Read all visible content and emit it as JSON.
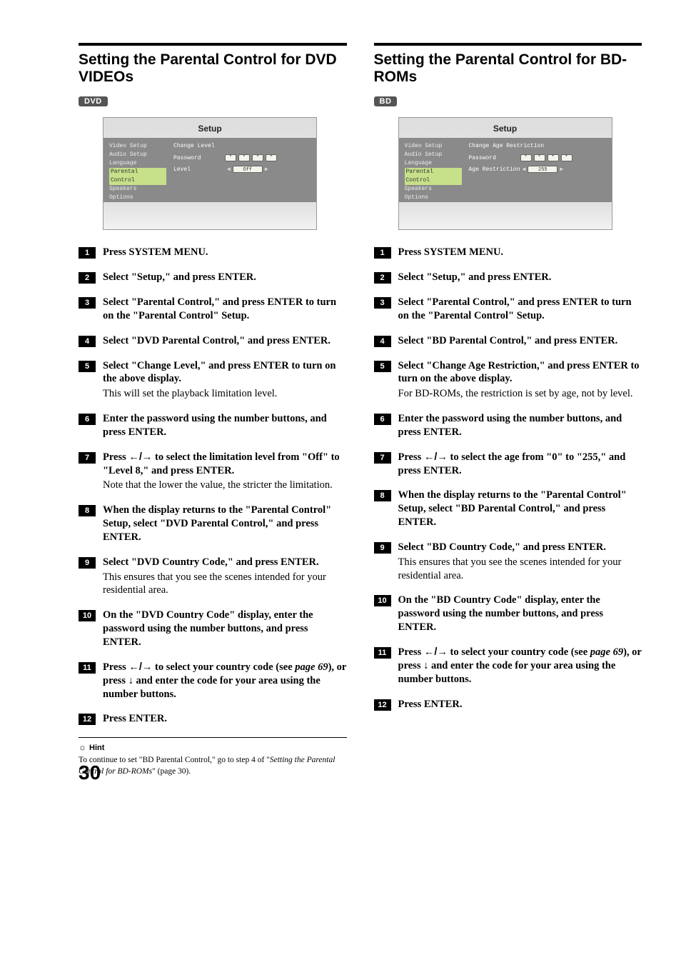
{
  "page_number": "30",
  "left": {
    "title": "Setting the Parental Control for DVD VIDEOs",
    "format_badge": "DVD",
    "osd": {
      "title": "Setup",
      "menu": [
        "Video Setup",
        "Audio Setup",
        "Language",
        "Parental Control",
        "Speakers",
        "Options"
      ],
      "selected_index": 3,
      "pane_title": "Change Level",
      "rows": [
        {
          "label": "Password",
          "value": "****"
        },
        {
          "label": "Level",
          "value": "Off"
        }
      ]
    },
    "steps": [
      {
        "bold": "Press SYSTEM MENU."
      },
      {
        "bold": "Select \"Setup,\" and press ENTER."
      },
      {
        "bold": "Select \"Parental Control,\" and press ENTER to turn on the \"Parental Control\" Setup."
      },
      {
        "bold": "Select \"DVD Parental Control,\" and press ENTER."
      },
      {
        "bold": "Select \"Change Level,\" and press ENTER to turn on the above display.",
        "note": "This will set the playback limitation level."
      },
      {
        "bold": "Enter the password using the number buttons, and press ENTER."
      },
      {
        "bold_pre": "Press ",
        "arrows": "←/→",
        "bold_post": " to select the limitation level from \"Off\" to \"Level 8,\" and press ENTER.",
        "note": "Note that the lower the value, the stricter the limitation."
      },
      {
        "bold": "When the display returns to the \"Parental Control\" Setup, select \"DVD Parental Control,\" and press ENTER."
      },
      {
        "bold": "Select \"DVD Country Code,\" and press ENTER.",
        "note": "This ensures that you see the scenes intended for your residential area."
      },
      {
        "bold": "On the \"DVD Country Code\" display, enter the password using the number buttons, and press ENTER."
      },
      {
        "bold_pre": "Press ",
        "arrows": "←/→",
        "bold_mid": " to select your country code (see ",
        "pageref": "page 69",
        "bold_mid2": "), or press ",
        "arrow_down": "↓",
        "bold_post": " and enter the code for your area using the number buttons."
      },
      {
        "bold": "Press ENTER."
      }
    ],
    "hint_label": "Hint",
    "hint_text_pre": "To continue to set \"BD Parental Control,\" go to step 4 of \"",
    "hint_text_em": "Setting the Parental Control for BD-ROMs",
    "hint_text_post": "\" (page 30)."
  },
  "right": {
    "title": "Setting the Parental Control for BD-ROMs",
    "format_badge": "BD",
    "osd": {
      "title": "Setup",
      "menu": [
        "Video Setup",
        "Audio Setup",
        "Language",
        "Parental Control",
        "Speakers",
        "Options"
      ],
      "selected_index": 3,
      "pane_title": "Change Age Restriction",
      "rows": [
        {
          "label": "Password",
          "value": "****"
        },
        {
          "label": "Age Restriction",
          "value": "255"
        }
      ]
    },
    "steps": [
      {
        "bold": "Press SYSTEM MENU."
      },
      {
        "bold": "Select \"Setup,\" and press ENTER."
      },
      {
        "bold": "Select \"Parental Control,\" and press ENTER to turn on the \"Parental Control\" Setup."
      },
      {
        "bold": "Select \"BD Parental Control,\" and press ENTER."
      },
      {
        "bold": "Select \"Change Age Restriction,\" and press ENTER to turn on the above display.",
        "note": "For BD-ROMs, the restriction is set by age, not by level."
      },
      {
        "bold": "Enter the password using the number buttons, and press ENTER."
      },
      {
        "bold_pre": "Press ",
        "arrows": "←/→",
        "bold_post": " to select the age from \"0\" to \"255,\" and press ENTER."
      },
      {
        "bold": "When the display returns to the \"Parental Control\" Setup, select \"BD Parental Control,\" and press ENTER."
      },
      {
        "bold": "Select \"BD Country Code,\" and press ENTER.",
        "note": "This ensures that you see the scenes intended for your residential area."
      },
      {
        "bold": "On the \"BD Country Code\" display, enter the password using the number buttons, and press ENTER."
      },
      {
        "bold_pre": "Press ",
        "arrows": "←/→",
        "bold_mid": " to select your country code (see ",
        "pageref": "page 69",
        "bold_mid2": "), or press ",
        "arrow_down": "↓",
        "bold_post": " and enter the code for your area using the number buttons."
      },
      {
        "bold": "Press ENTER."
      }
    ]
  }
}
